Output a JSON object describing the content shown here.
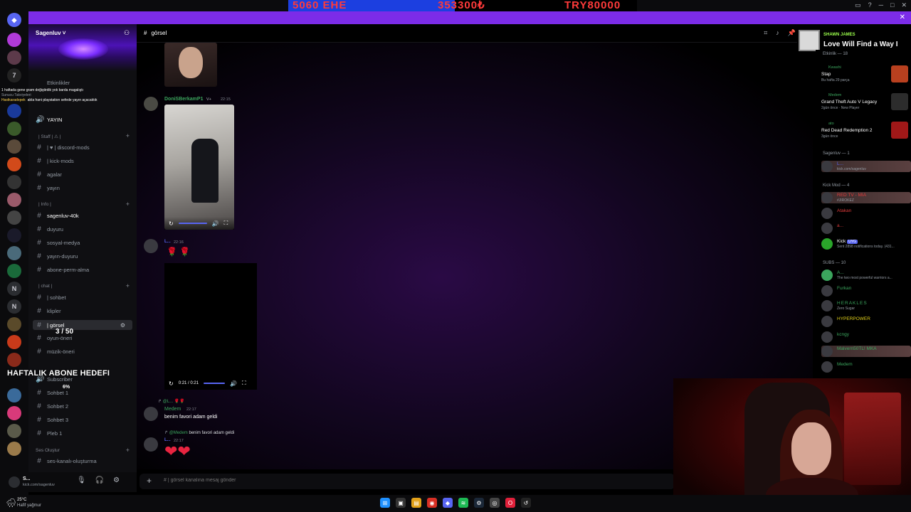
{
  "overlay": {
    "ticker_left": "5060 EHE",
    "ticker_mid": "353300₺",
    "ticker_right": "TRY80000"
  },
  "colors": {
    "accent": "#7c2ce8",
    "discord_blue": "#5865f2",
    "online_green": "#3ba55d",
    "mod_red": "#e03b3b"
  },
  "server": {
    "name": "Sagenluv",
    "events_label": "Etkinlikler"
  },
  "stream_chat": [
    {
      "user": "",
      "msg": "1 haftada gene gram değiştirdik yok barda magalıştı"
    },
    {
      "user": "",
      "msg": "Sunucu Takviyeleri"
    },
    {
      "user": "Hastkaradopek",
      "msg": "abla hani playstation sefede yayın açacaktık"
    }
  ],
  "sidebar": {
    "channels": [
      {
        "label": "YAYIN"
      },
      {
        "label": "| Staff | ⚠ |",
        "type": "category"
      },
      {
        "label": "| ♥ | discord-mods"
      },
      {
        "label": "| kick-mods"
      },
      {
        "label": "agalar"
      },
      {
        "label": "yayın"
      },
      {
        "label": "| Info |",
        "type": "category"
      },
      {
        "label": "sagenluv-40k"
      },
      {
        "label": "duyuru"
      },
      {
        "label": "sosyal-medya"
      },
      {
        "label": "yayın-duyuru"
      },
      {
        "label": "abone-perm-alma"
      },
      {
        "label": "| chat |",
        "type": "category"
      },
      {
        "label": "| sohbet"
      },
      {
        "label": "klipler"
      },
      {
        "label": "| görsel"
      },
      {
        "label": "oyun-öneri"
      },
      {
        "label": "müzik-öneri"
      },
      {
        "label": "Subscriber"
      },
      {
        "label": "Sohbet 1"
      },
      {
        "label": "Sohbet 2"
      },
      {
        "label": "Sohbet 3"
      },
      {
        "label": "Pleb 1"
      },
      {
        "label": "Ses Oluştur",
        "type": "category"
      },
      {
        "label": "ses-kanalı-oluşturma"
      }
    ]
  },
  "goal": {
    "label": "HAFTALIK ABONE HEDEFI",
    "count": "3 / 50",
    "percent": "6%"
  },
  "user_panel": {
    "name": "S...",
    "status": "kick.com/sagenluv"
  },
  "chat": {
    "channel_name": "görsel",
    "composer_placeholder": "# | görsel kanalına mesaj gönder",
    "messages": [
      {
        "author": "DoniSBerkamP1",
        "badge": "V+",
        "time": "22:15"
      },
      {
        "author": "L...",
        "time": "22:16"
      },
      {
        "reply_to": "@L...",
        "author": "Medem",
        "time": "22:17",
        "text": "benim favori adam geldi"
      },
      {
        "reply_to": "@Medem",
        "reply_text": "benim favori adam geldi",
        "author": "L...",
        "time": "22:17"
      }
    ],
    "video_time": "0:21 / 0:21"
  },
  "now_playing": {
    "artist": "SHAWN JAMES",
    "song": "Love Will Find a Way I"
  },
  "members": {
    "activity_header": "Etkinlik — 18",
    "activities": [
      {
        "user": "Kwashi",
        "game": "Stap",
        "sub": "Bu hafta 29 parça",
        "thumb_color": "#b8401f"
      },
      {
        "user": "Medem",
        "game": "Grand Theft Auto V Legacy",
        "sub": "2gün önce · New Player",
        "thumb_color": "#2c2c2c"
      },
      {
        "user": "ato",
        "game": "Red Dead Redemption 2",
        "sub": "3gün önce",
        "thumb_color": "#a01818"
      }
    ],
    "sagenluv_header": "Sagenluv — 1",
    "sagenluv_member": {
      "name": "L...",
      "sub": "kick.com/sagenluv"
    },
    "mod_header": "Kick Mod — 4",
    "mods": [
      {
        "name": "RED TV - MIA",
        "sub": "#JIROKEZ"
      },
      {
        "name": "Atakan",
        "sub": ""
      },
      {
        "name": "a...",
        "sub": ""
      },
      {
        "name": "Kick",
        "badge": "UYG",
        "sub": "Sent 2898 notifications today. (431..."
      }
    ],
    "subs_header": "SUBS — 10",
    "subs": [
      {
        "name": "A...",
        "sub": "The two most powerful warriors a..."
      },
      {
        "name": "Furkan",
        "sub": ""
      },
      {
        "name": "HERAKLES",
        "sub": "Zero Sugar"
      },
      {
        "name": "HYPERPOWER",
        "sub": ""
      },
      {
        "name": "kcngy",
        "sub": ""
      },
      {
        "name": "Malvern50TL! MKA",
        "sub": ""
      },
      {
        "name": "Medem",
        "sub": ""
      }
    ]
  },
  "taskbar": {
    "temp": "25°C",
    "weather": "Hafif yağmur"
  }
}
